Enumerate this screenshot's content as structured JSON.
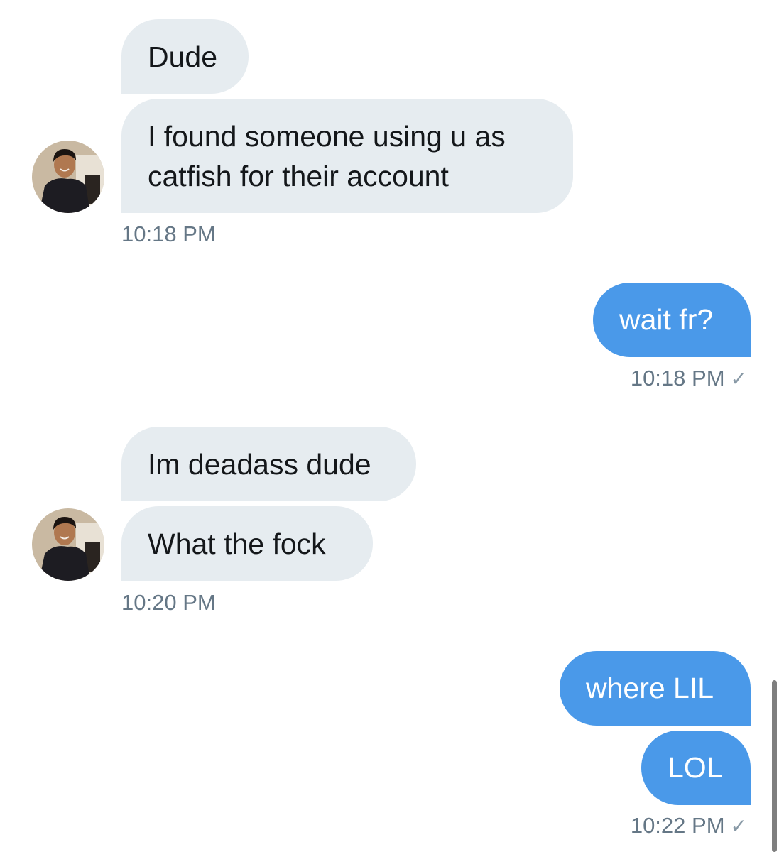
{
  "thread": {
    "groups": [
      {
        "side": "received",
        "messages": [
          "Dude",
          "I found someone using u as catfish for their account"
        ],
        "time": "10:18 PM"
      },
      {
        "side": "sent",
        "messages": [
          "wait fr?"
        ],
        "time": "10:18 PM",
        "read_receipt": "✓"
      },
      {
        "side": "received",
        "messages": [
          "Im deadass dude",
          "What the fock"
        ],
        "time": "10:20 PM"
      },
      {
        "side": "sent",
        "messages": [
          "where LIL",
          "LOL"
        ],
        "time": "10:22 PM",
        "read_receipt": "✓"
      }
    ]
  },
  "avatar": {
    "icon": "profile-photo",
    "background_color": "#c9b9a2",
    "skin_color": "#b07850",
    "hair_color": "#1b1411",
    "shirt_color": "#1d1c22"
  },
  "colors": {
    "received_bubble": "#e6ecf0",
    "sent_bubble": "#4a99e9",
    "timestamp": "#657786"
  }
}
